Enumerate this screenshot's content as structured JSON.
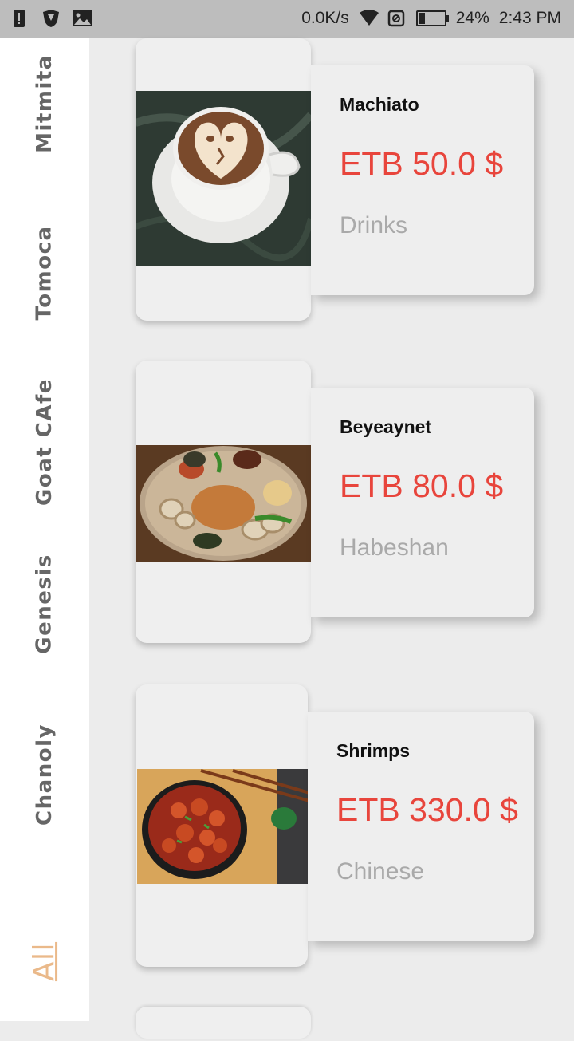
{
  "status_bar": {
    "speed": "0.0K/s",
    "battery_pct": "24%",
    "battery_level": 0.24,
    "time": "2:43 PM",
    "icons": [
      "alert-icon",
      "shield-icon",
      "image-icon",
      "wifi-icon",
      "do-not-disturb-icon",
      "battery-icon"
    ]
  },
  "sidebar": {
    "items": [
      {
        "label": "Mitmita"
      },
      {
        "label": "Tomoca"
      },
      {
        "label": "Goat CAfe"
      },
      {
        "label": "Genesis"
      },
      {
        "label": "Chanoly"
      },
      {
        "label": "All"
      }
    ],
    "active_color": "#eab98a"
  },
  "items": [
    {
      "name": "Machiato",
      "price": "ETB 50.0 $",
      "category": "Drinks"
    },
    {
      "name": "Beyeaynet",
      "price": "ETB 80.0 $",
      "category": "Habeshan"
    },
    {
      "name": "Shrimps",
      "price": "ETB 330.0 $",
      "category": "Chinese"
    }
  ],
  "colors": {
    "price": "#e8453c",
    "category": "#a9a9a9",
    "background": "#ececec"
  }
}
